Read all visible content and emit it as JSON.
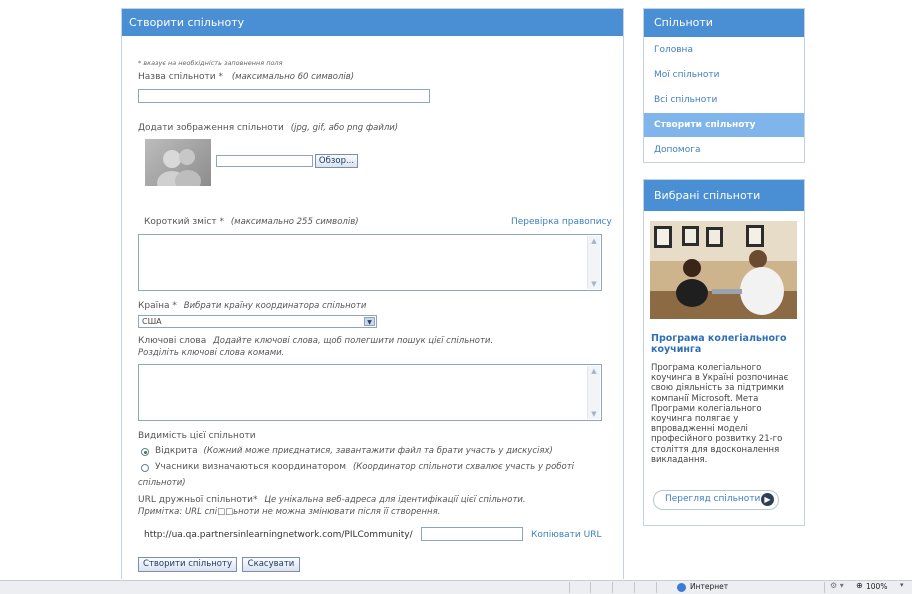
{
  "main": {
    "title": "Створити спільноту",
    "required_note": "* вказує на необхідність заповнення поля",
    "name_label": "Назва спільноти *",
    "name_hint": "(максимально 60 символів)",
    "image_label": "Додати зображення спільноти",
    "image_hint": "(jpg, gif, або png файли)",
    "browse_button": "Обзор...",
    "summary_label": "Короткий зміст *",
    "summary_hint": "(максимально 255 символів)",
    "spellcheck_link": "Перевірка правопису",
    "country_label": "Країна *",
    "country_hint": "Вибрати країну координатора спільноти",
    "country_value": "США",
    "keywords_label": "Ключові слова",
    "keywords_hint_1": "Додайте ключові слова, щоб полегшити пошук цієї спільноти.",
    "keywords_hint_2": "Розділіть ключові слова комами.",
    "visibility_label": "Видимість цієї спільноти",
    "visibility_open": "Відкрита",
    "visibility_open_hint": "(Кожний може приєднатися, завантажити файл та брати участь у дискусіях)",
    "visibility_approved": "Учасники визначаються координатором",
    "visibility_approved_hint_1": "(Координатор спільноти схвалює участь у роботі",
    "visibility_approved_hint_2": "спільноти)",
    "url_label": "URL дружньої спільноти*",
    "url_hint": "Це унікальна веб-адреса для ідентифікації цієї спільноти.",
    "url_note": "Примітка: URL спі□□ьноти не можна змінювати після її створення.",
    "url_prefix": "http://ua.qa.partnersinlearningnetwork.com/PILCommunity/",
    "copy_url_link": "Копіювати URL",
    "create_button": "Створити спільноту",
    "cancel_button": "Скасувати"
  },
  "sidebar": {
    "title": "Спільноти",
    "items": [
      {
        "label": "Головна"
      },
      {
        "label": "Мої спільноти"
      },
      {
        "label": "Всі спільноти"
      },
      {
        "label": "Створити спільноту"
      },
      {
        "label": "Допомога"
      }
    ]
  },
  "featured": {
    "title": "Вибрані спільноти",
    "heading": "Програма колегіального коучинга",
    "body": "Програма колегіального коучинга в Україні розпочинає свою діяльність за підтримки компанії Microsoft. Мета Програми колегіального коучинга полягає у впровадженні моделі професійного розвитку 21-го століття для вдосконалення викладання.",
    "button": "Перегляд спільноти"
  },
  "statusbar": {
    "zone": "Интернет",
    "zoom": "100%"
  }
}
